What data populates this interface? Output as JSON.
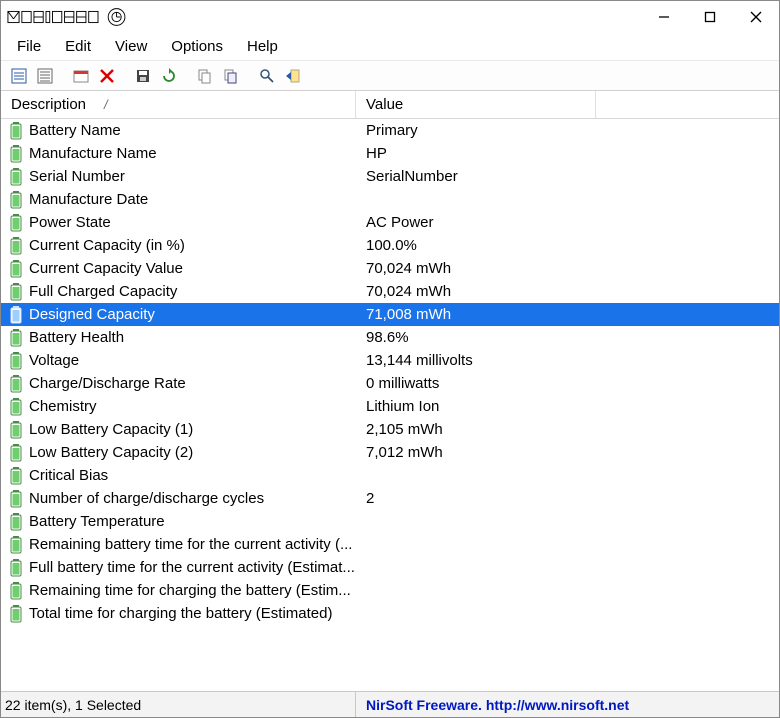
{
  "app": {
    "logo_title": "MOBILE"
  },
  "menu": {
    "file": "File",
    "edit": "Edit",
    "view": "View",
    "options": "Options",
    "help": "Help"
  },
  "columns": {
    "description": "Description",
    "sort_marker": "/",
    "value": "Value"
  },
  "rows": [
    {
      "desc": "Battery Name",
      "val": "Primary",
      "selected": false
    },
    {
      "desc": "Manufacture Name",
      "val": "HP",
      "selected": false
    },
    {
      "desc": "Serial Number",
      "val": "SerialNumber",
      "selected": false
    },
    {
      "desc": "Manufacture Date",
      "val": "",
      "selected": false
    },
    {
      "desc": "Power State",
      "val": "AC Power",
      "selected": false
    },
    {
      "desc": "Current Capacity (in %)",
      "val": "100.0%",
      "selected": false
    },
    {
      "desc": "Current Capacity Value",
      "val": "70,024 mWh",
      "selected": false
    },
    {
      "desc": "Full Charged Capacity",
      "val": "70,024 mWh",
      "selected": false
    },
    {
      "desc": "Designed Capacity",
      "val": "71,008 mWh",
      "selected": true
    },
    {
      "desc": "Battery Health",
      "val": "98.6%",
      "selected": false
    },
    {
      "desc": "Voltage",
      "val": "13,144 millivolts",
      "selected": false
    },
    {
      "desc": "Charge/Discharge Rate",
      "val": "0 milliwatts",
      "selected": false
    },
    {
      "desc": "Chemistry",
      "val": "Lithium Ion",
      "selected": false
    },
    {
      "desc": "Low Battery Capacity (1)",
      "val": "2,105 mWh",
      "selected": false
    },
    {
      "desc": "Low Battery Capacity (2)",
      "val": "7,012 mWh",
      "selected": false
    },
    {
      "desc": "Critical Bias",
      "val": "",
      "selected": false
    },
    {
      "desc": "Number of charge/discharge cycles",
      "val": "2",
      "selected": false
    },
    {
      "desc": "Battery Temperature",
      "val": "",
      "selected": false
    },
    {
      "desc": "Remaining battery time for the current activity (...",
      "val": "",
      "selected": false
    },
    {
      "desc": "Full battery time for the current activity (Estimat...",
      "val": "",
      "selected": false
    },
    {
      "desc": "Remaining time for charging the battery (Estim...",
      "val": "",
      "selected": false
    },
    {
      "desc": "Total  time for charging the battery (Estimated)",
      "val": "",
      "selected": false
    }
  ],
  "status": {
    "left": "22 item(s), 1 Selected",
    "right": "NirSoft Freeware.  http://www.nirsoft.net"
  },
  "colors": {
    "selection": "#1a73e8",
    "link": "#0018c0",
    "battery_green": "#3fb33f"
  }
}
